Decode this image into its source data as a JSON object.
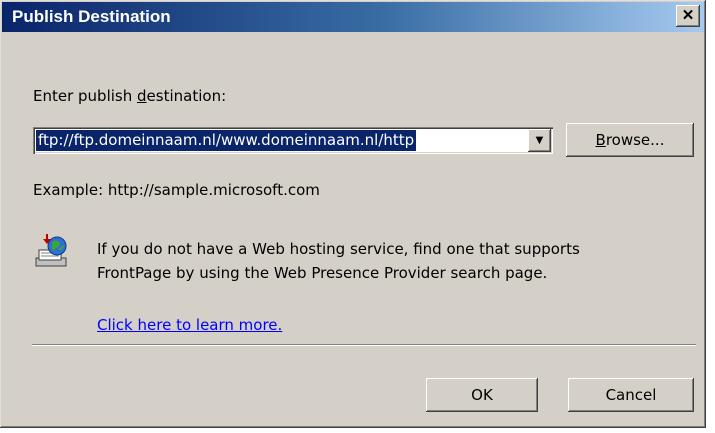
{
  "window": {
    "title": "Publish Destination",
    "close_glyph": "✕"
  },
  "form": {
    "label_prefix": "Enter publish ",
    "label_mnemonic": "d",
    "label_suffix": "estination:",
    "destination_value": "ftp://ftp.domeinnaam.nl/www.domeinnaam.nl/http",
    "dropdown_glyph": "▼",
    "browse_mnemonic": "B",
    "browse_rest": "rowse...",
    "example": "Example: http://sample.microsoft.com"
  },
  "info": {
    "icon": "web-publish-icon",
    "text_line1": "If you do not have a Web hosting service, find one that supports",
    "text_line2": "FrontPage by using the Web Presence Provider search page.",
    "link": "Click here to learn more."
  },
  "buttons": {
    "ok": "OK",
    "cancel": "Cancel"
  }
}
